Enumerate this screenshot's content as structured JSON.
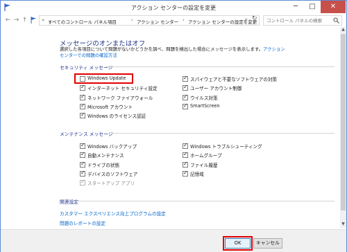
{
  "window": {
    "title": "アクション センターの設定を変更",
    "minimize": "─",
    "maximize": "□",
    "close": "✕"
  },
  "address_bar": {
    "back": "←",
    "forward": "→",
    "up": "↑",
    "prefix": "«",
    "crumbs": [
      "すべてのコントロール パネル項目",
      "アクション センター",
      "アクション センターの設定を変更"
    ],
    "separator": "›",
    "dropdown": "v",
    "refresh": "↻",
    "search_placeholder": "コントロール パネルの検索"
  },
  "page": {
    "title": "メッセージのオンまたはオフ",
    "desc_text": "選択した各項目について問題がないかどうかを調べ、問題を検出した場合にメッセージを表示します。",
    "desc_link": "アクション センターでの問題の確認方法"
  },
  "security": {
    "heading": "セキュリティ メッセージ",
    "items": [
      {
        "label": "Windows Update",
        "checked": false
      },
      {
        "label": "インターネット セキュリティ設定",
        "checked": true
      },
      {
        "label": "ネットワーク ファイアウォール",
        "checked": true
      },
      {
        "label": "Microsoft アカウント",
        "checked": true
      },
      {
        "label": "Windows のライセンス認証",
        "checked": true
      },
      {
        "label": "スパイウェアと不要なソフトウェアの対策",
        "checked": true
      },
      {
        "label": "ユーザー アカウント制御",
        "checked": true
      },
      {
        "label": "ウイルス対策",
        "checked": true
      },
      {
        "label": "SmartScreen",
        "checked": true
      }
    ]
  },
  "maintenance": {
    "heading": "メンテナンス メッセージ",
    "items": [
      {
        "label": "Windows バックアップ",
        "checked": true
      },
      {
        "label": "自動メンテナンス",
        "checked": true
      },
      {
        "label": "ドライブの状態",
        "checked": true
      },
      {
        "label": "デバイスのソフトウェア",
        "checked": true
      },
      {
        "label": "スタートアップ アプリ",
        "checked": true,
        "disabled": true
      },
      {
        "label": "Windows トラブルシューティング",
        "checked": true
      },
      {
        "label": "ホームグループ",
        "checked": true
      },
      {
        "label": "ファイル履歴",
        "checked": true
      },
      {
        "label": "記憶域",
        "checked": true
      }
    ]
  },
  "related": {
    "heading": "関連設定",
    "links": [
      "カスタマー エクスペリエンス向上プログラムの設定",
      "問題のレポートの設定"
    ]
  },
  "footer": {
    "ok": "OK",
    "cancel": "キャンセル"
  },
  "colors": {
    "title_blue": "#1e3287",
    "link_blue": "#0066cc",
    "highlight_red": "#e00000",
    "close_red": "#c7504b"
  },
  "icons": {
    "title": "flag-icon",
    "search": "search-icon",
    "scroll_up": "triangle-up-icon",
    "scroll_down": "triangle-down-icon"
  }
}
